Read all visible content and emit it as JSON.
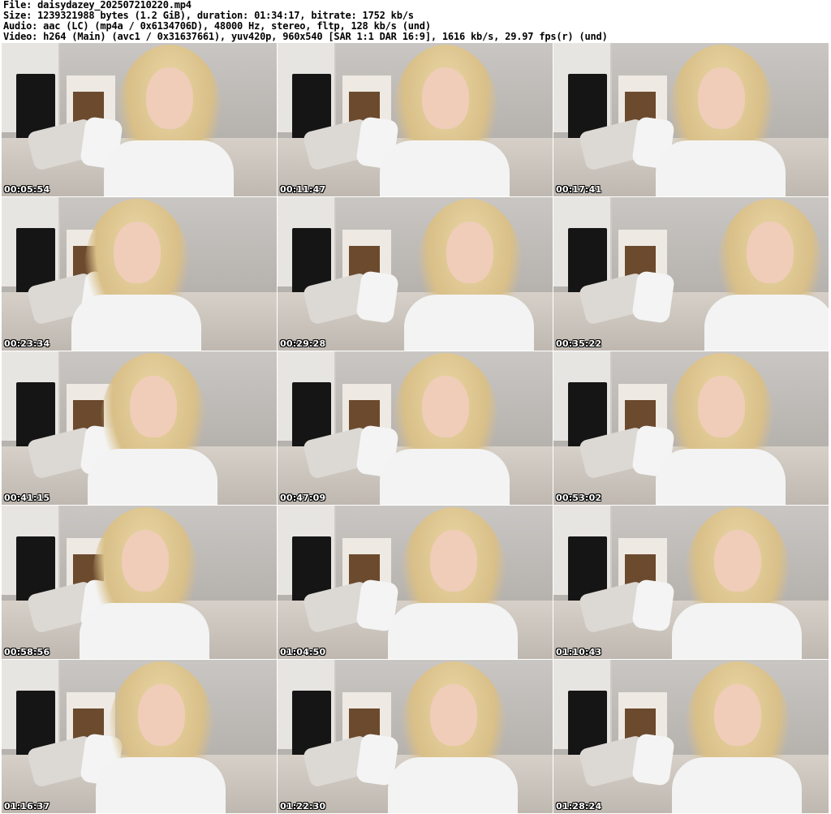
{
  "header": {
    "file_line": "File: daisydazey_202507210220.mp4",
    "size_line": "Size: 1239321988 bytes (1.2 GiB), duration: 01:34:17, bitrate: 1752 kb/s",
    "audio_line": "Audio: aac (LC) (mp4a / 0x6134706D), 48000 Hz, stereo, fltp, 128 kb/s (und)",
    "video_line": "Video: h264 (Main) (avc1 / 0x31637661), yuv420p, 960x540 [SAR 1:1 DAR 16:9], 1616 kb/s, 29.97 fps(r) (und)"
  },
  "thumbnails": [
    {
      "timestamp": "00:05:54"
    },
    {
      "timestamp": "00:11:47"
    },
    {
      "timestamp": "00:17:41"
    },
    {
      "timestamp": "00:23:34"
    },
    {
      "timestamp": "00:29:28"
    },
    {
      "timestamp": "00:35:22"
    },
    {
      "timestamp": "00:41:15"
    },
    {
      "timestamp": "00:47:09"
    },
    {
      "timestamp": "00:53:02"
    },
    {
      "timestamp": "00:58:56"
    },
    {
      "timestamp": "01:04:50"
    },
    {
      "timestamp": "01:10:43"
    },
    {
      "timestamp": "01:16:37"
    },
    {
      "timestamp": "01:22:30"
    },
    {
      "timestamp": "01:28:24"
    }
  ]
}
